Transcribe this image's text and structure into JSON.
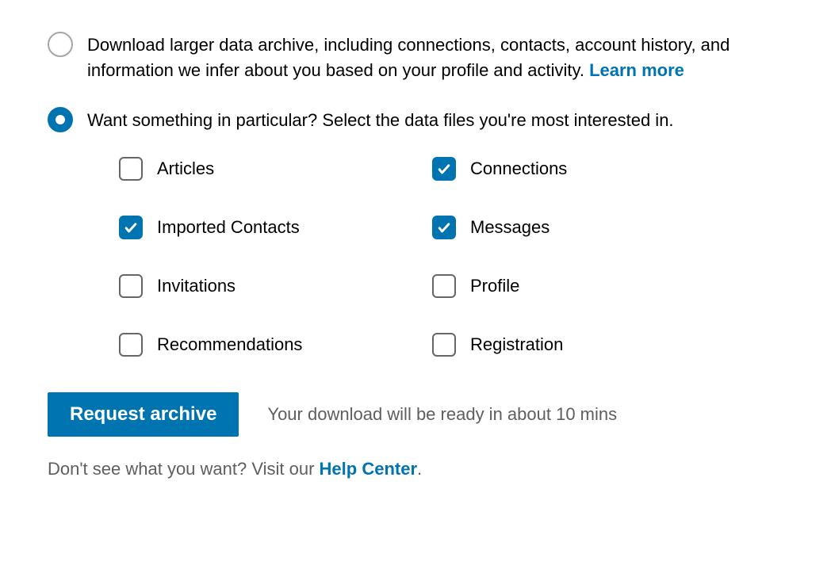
{
  "options": {
    "larger_archive": {
      "text": "Download larger data archive, including connections, contacts, account history, and information we infer about you based on your profile and activity. ",
      "learn_more": "Learn more",
      "selected": false
    },
    "particular": {
      "text": "Want something in particular? Select the data files you're most interested in.",
      "selected": true
    }
  },
  "checkboxes": {
    "articles": {
      "label": "Articles",
      "checked": false
    },
    "connections": {
      "label": "Connections",
      "checked": true
    },
    "imported_contacts": {
      "label": "Imported Contacts",
      "checked": true
    },
    "messages": {
      "label": "Messages",
      "checked": true
    },
    "invitations": {
      "label": "Invitations",
      "checked": false
    },
    "profile": {
      "label": "Profile",
      "checked": false
    },
    "recommendations": {
      "label": "Recommendations",
      "checked": false
    },
    "registration": {
      "label": "Registration",
      "checked": false
    }
  },
  "action": {
    "button": "Request archive",
    "status": "Your download will be ready in about 10 mins"
  },
  "help": {
    "prefix": "Don't see what you want? Visit our ",
    "link": "Help Center",
    "suffix": "."
  }
}
